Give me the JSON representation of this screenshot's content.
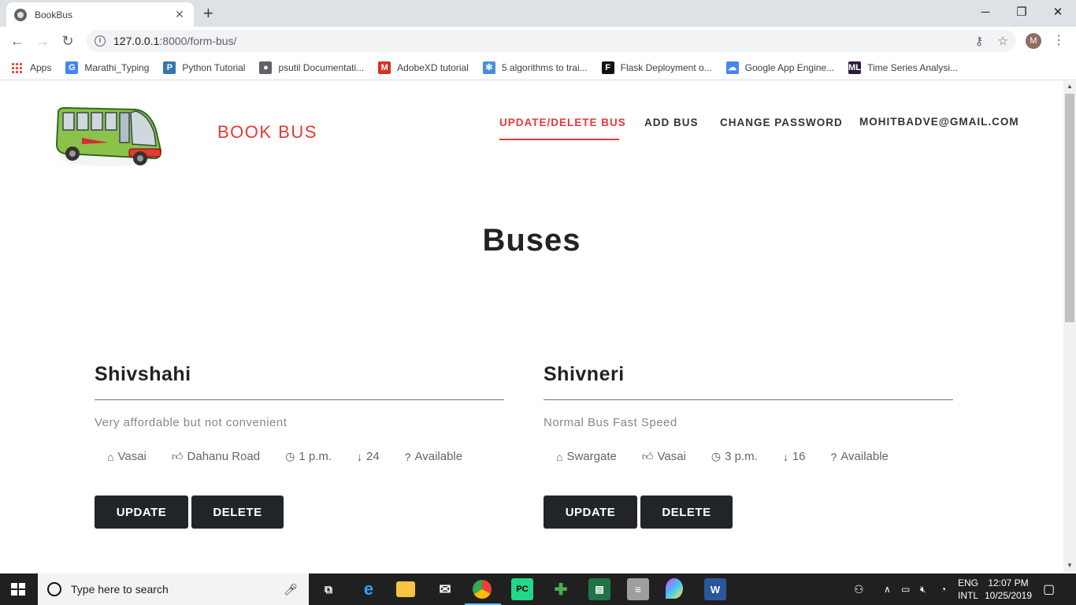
{
  "browser": {
    "tab_title": "BookBus",
    "tab_close": "✕",
    "new_tab": "+",
    "url_host": "127.0.0.1",
    "url_rest": ":8000/form-bus/",
    "avatar_letter": "M",
    "bookmarks": [
      {
        "label": "Apps",
        "icon": "apps-grid-icon"
      },
      {
        "label": "Marathi_Typing",
        "icon": "google-icon",
        "color": "#4285f4",
        "glyph": "G"
      },
      {
        "label": "Python Tutorial",
        "icon": "python-icon",
        "color": "#3776ab",
        "glyph": "P"
      },
      {
        "label": "psutil Documentati...",
        "icon": "globe-icon",
        "color": "#5f6368",
        "glyph": "●"
      },
      {
        "label": "AdobeXD tutorial",
        "icon": "medium-icon",
        "color": "#d93025",
        "glyph": "M"
      },
      {
        "label": "5 algorithms to trai...",
        "icon": "gear-icon",
        "color": "#4a90d9",
        "glyph": "✻"
      },
      {
        "label": "Flask Deployment o...",
        "icon": "flask-icon",
        "color": "#111111",
        "glyph": "F"
      },
      {
        "label": "Google App Engine...",
        "icon": "cloud-icon",
        "color": "#4285f4",
        "glyph": "☁"
      },
      {
        "label": "Time Series Analysi...",
        "icon": "ml-icon",
        "color": "#2d1b3d",
        "glyph": "ML"
      }
    ]
  },
  "site": {
    "brand": "BOOK BUS",
    "nav": [
      "UPDATE/DELETE BUS",
      "ADD BUS",
      "CHANGE PASSWORD",
      "MOHITBADVE@GMAIL.COM"
    ],
    "active_nav": "UPDATE/DELETE BUS",
    "heading": "Buses",
    "accent_color": "#e53935",
    "button_color": "#212529"
  },
  "buses": [
    {
      "name": "Shivshahi",
      "description": "Very affordable but not convenient",
      "source": "Vasai",
      "destination": "Dahanu Road",
      "time": "1 p.m.",
      "seats": "24",
      "status": "Available",
      "update_label": "UPDATE",
      "delete_label": "DELETE"
    },
    {
      "name": "Shivneri",
      "description": "Normal Bus Fast Speed",
      "source": "Swargate",
      "destination": "Vasai",
      "time": "3 p.m.",
      "seats": "16",
      "status": "Available",
      "update_label": "UPDATE",
      "delete_label": "DELETE"
    }
  ],
  "taskbar": {
    "search_placeholder": "Type here to search",
    "lang_top": "ENG",
    "lang_bottom": "INTL",
    "time": "12:07 PM",
    "date": "10/25/2019"
  }
}
